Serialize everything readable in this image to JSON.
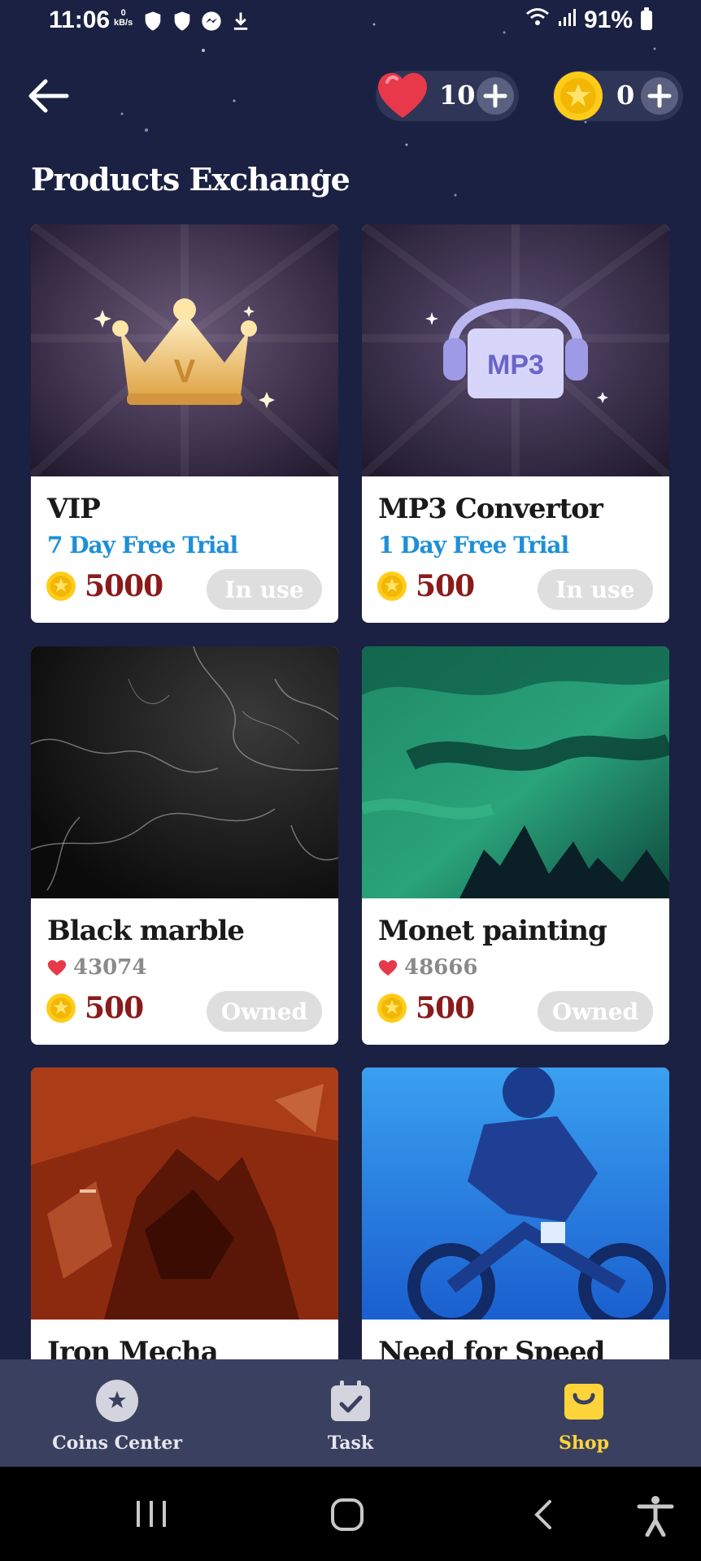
{
  "status_bar": {
    "time": "11:06",
    "net_speed_value": "0",
    "net_speed_unit": "kB/s",
    "battery": "91%"
  },
  "header": {
    "hearts": "10",
    "coins": "0"
  },
  "section_title": "Products Exchange",
  "products": [
    {
      "name": "VIP",
      "subtitle": "7 Day Free Trial",
      "price": "5000",
      "state": "In use"
    },
    {
      "name": "MP3 Convertor",
      "subtitle": "1 Day Free Trial",
      "price": "500",
      "state": "In use",
      "art_text": "MP3"
    },
    {
      "name": "Black marble",
      "likes": "43074",
      "price": "500",
      "state": "Owned"
    },
    {
      "name": "Monet painting",
      "likes": "48666",
      "price": "500",
      "state": "Owned"
    },
    {
      "name": "Iron Mecha"
    },
    {
      "name": "Need for Speed"
    }
  ],
  "vip_art_letter": "V",
  "nav": {
    "coins_center": "Coins Center",
    "task": "Task",
    "shop": "Shop",
    "active": "Shop"
  },
  "colors": {
    "background": "#1b2142",
    "price": "#8b1a1a",
    "subtitle": "#1e8fd8",
    "active_nav": "#ffd43b",
    "coin": "#ffcc1a",
    "heart": "#e8394a"
  }
}
